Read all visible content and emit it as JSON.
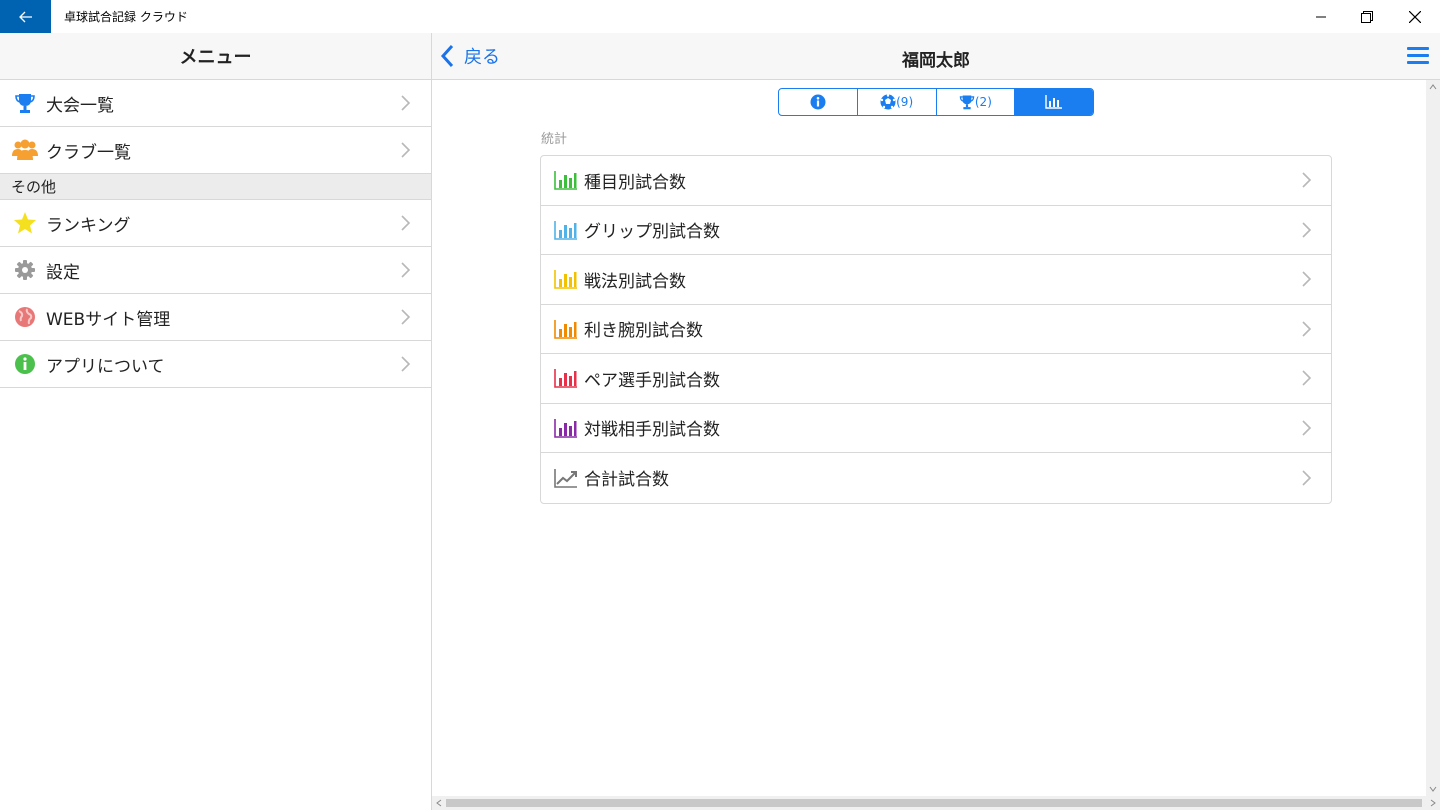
{
  "window": {
    "title": "卓球試合記録 クラウド",
    "accent": "#0063b1"
  },
  "sidebar": {
    "header": "メニュー",
    "items": [
      {
        "label": "大会一覧",
        "icon": "trophy-icon"
      },
      {
        "label": "クラブ一覧",
        "icon": "users-icon"
      }
    ],
    "section": "その他",
    "other_items": [
      {
        "label": "ランキング",
        "icon": "star-icon"
      },
      {
        "label": "設定",
        "icon": "gear-icon"
      },
      {
        "label": "WEBサイト管理",
        "icon": "globe-icon"
      },
      {
        "label": "アプリについて",
        "icon": "info-icon"
      }
    ]
  },
  "nav": {
    "back_label": "戻る",
    "title": "福岡太郎"
  },
  "segments": [
    {
      "icon": "info-icon",
      "count": ""
    },
    {
      "icon": "ball-icon",
      "count": "(9)"
    },
    {
      "icon": "trophy-icon",
      "count": "(2)"
    },
    {
      "icon": "bar-chart-icon",
      "count": "",
      "active": true
    }
  ],
  "stats": {
    "section_label": "統計",
    "rows": [
      {
        "label": "種目別試合数",
        "color": "#3cc03c"
      },
      {
        "label": "グリップ別試合数",
        "color": "#4fb3e8"
      },
      {
        "label": "戦法別試合数",
        "color": "#f2c200"
      },
      {
        "label": "利き腕別試合数",
        "color": "#f08a00"
      },
      {
        "label": "ペア選手別試合数",
        "color": "#e8304a"
      },
      {
        "label": "対戦相手別試合数",
        "color": "#8a2aa8"
      },
      {
        "label": "合計試合数",
        "color": "#777777"
      }
    ]
  }
}
